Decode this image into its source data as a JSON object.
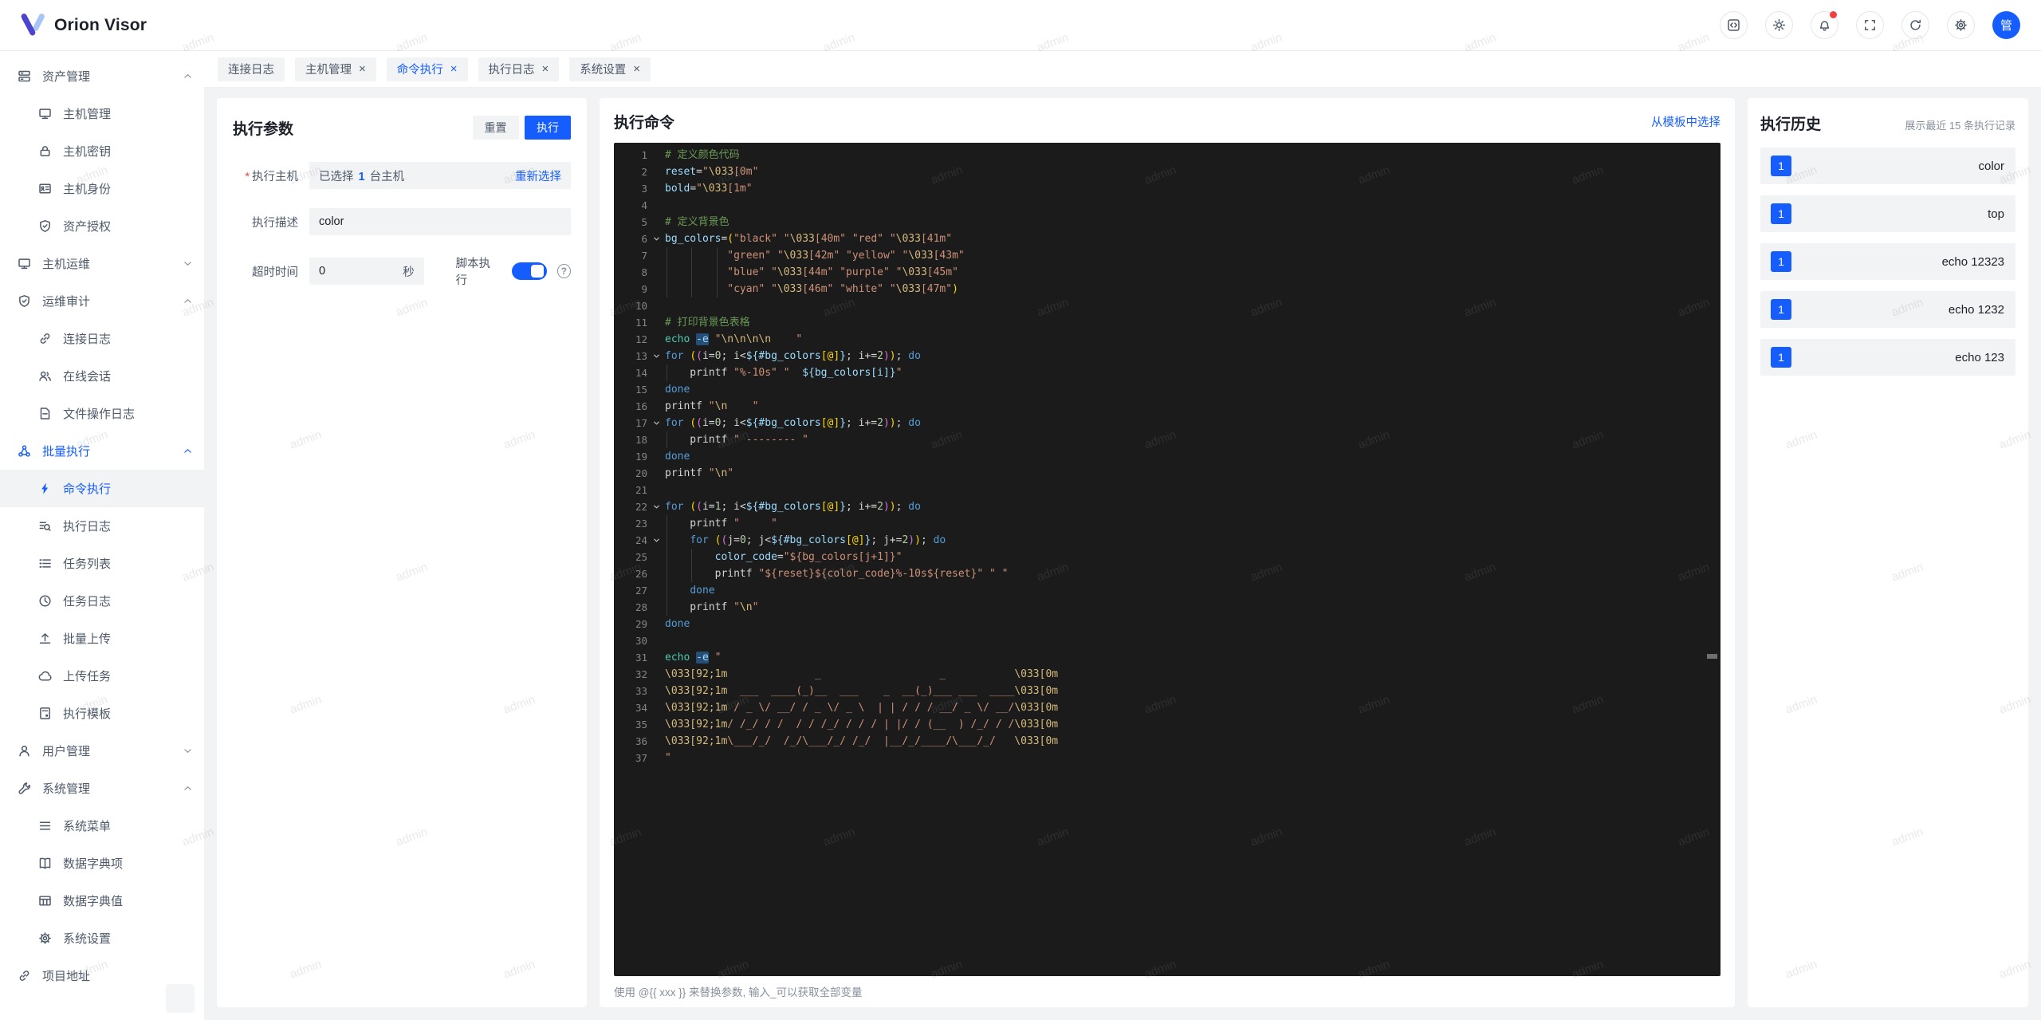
{
  "app": {
    "title": "Orion Visor"
  },
  "colors": {
    "accent": "#165dff",
    "danger": "#f53f3f",
    "editor_bg": "#1b1b1b",
    "success_badge": "#165dff"
  },
  "watermark_text": "admin",
  "header": {
    "avatar_text": "管",
    "actions": [
      {
        "icon": "code-window-icon"
      },
      {
        "icon": "theme-icon"
      },
      {
        "icon": "notifications-icon",
        "badge": true
      },
      {
        "icon": "fullscreen-icon"
      },
      {
        "icon": "refresh-icon"
      },
      {
        "icon": "settings-icon"
      }
    ]
  },
  "tabs": [
    {
      "label": "连接日志",
      "closable": false,
      "active": false
    },
    {
      "label": "主机管理",
      "closable": true,
      "active": false
    },
    {
      "label": "命令执行",
      "closable": true,
      "active": true
    },
    {
      "label": "执行日志",
      "closable": true,
      "active": false
    },
    {
      "label": "系统设置",
      "closable": true,
      "active": false
    }
  ],
  "sidebar": {
    "items": [
      {
        "label": "资产管理",
        "icon": "server",
        "depth": 0,
        "chevron": "up"
      },
      {
        "label": "主机管理",
        "icon": "monitor",
        "depth": 1
      },
      {
        "label": "主机密钥",
        "icon": "lock",
        "depth": 1
      },
      {
        "label": "主机身份",
        "icon": "idcard",
        "depth": 1
      },
      {
        "label": "资产授权",
        "icon": "shield",
        "depth": 1
      },
      {
        "label": "主机运维",
        "icon": "monitor",
        "depth": 0,
        "chevron": "down"
      },
      {
        "label": "运维审计",
        "icon": "shield",
        "depth": 0,
        "chevron": "up"
      },
      {
        "label": "连接日志",
        "icon": "link",
        "depth": 1
      },
      {
        "label": "在线会话",
        "icon": "users",
        "depth": 1
      },
      {
        "label": "文件操作日志",
        "icon": "file",
        "depth": 1
      },
      {
        "label": "批量执行",
        "icon": "cluster",
        "depth": 0,
        "chevron": "up",
        "active": true
      },
      {
        "label": "命令执行",
        "icon": "bolt",
        "depth": 1,
        "active": true,
        "selected": true
      },
      {
        "label": "执行日志",
        "icon": "searchlist",
        "depth": 1
      },
      {
        "label": "任务列表",
        "icon": "list",
        "depth": 1
      },
      {
        "label": "任务日志",
        "icon": "clock",
        "depth": 1
      },
      {
        "label": "批量上传",
        "icon": "upload",
        "depth": 1
      },
      {
        "label": "上传任务",
        "icon": "cloud",
        "depth": 1
      },
      {
        "label": "执行模板",
        "icon": "template",
        "depth": 1
      },
      {
        "label": "用户管理",
        "icon": "user",
        "depth": 0,
        "chevron": "down"
      },
      {
        "label": "系统管理",
        "icon": "wrench",
        "depth": 0,
        "chevron": "up"
      },
      {
        "label": "系统菜单",
        "icon": "menu",
        "depth": 1
      },
      {
        "label": "数据字典项",
        "icon": "book",
        "depth": 1
      },
      {
        "label": "数据字典值",
        "icon": "table",
        "depth": 1
      },
      {
        "label": "系统设置",
        "icon": "gear",
        "depth": 1
      },
      {
        "label": "项目地址",
        "icon": "link",
        "depth": 0
      }
    ]
  },
  "params": {
    "title": "执行参数",
    "reset_label": "重置",
    "run_label": "执行",
    "host": {
      "label": "执行主机",
      "prefix": "已选择",
      "count": "1",
      "suffix": "台主机",
      "reselect": "重新选择"
    },
    "desc": {
      "label": "执行描述",
      "value": "color"
    },
    "timeout": {
      "label": "超时时间",
      "value": "0",
      "unit": "秒"
    },
    "script": {
      "label": "脚本执行",
      "enabled": true
    }
  },
  "command": {
    "title": "执行命令",
    "template_link": "从模板中选择",
    "hint": "使用 @{{ xxx }} 来替换参数, 输入_可以获取全部变量",
    "editor": {
      "lines": [
        {
          "t": [
            [
              "c",
              "# 定义颜色代码"
            ]
          ]
        },
        {
          "t": [
            [
              "v",
              "reset"
            ],
            [
              "p",
              "="
            ],
            [
              "s",
              "\""
            ],
            [
              "e",
              "\\033"
            ],
            [
              "s",
              "[0m\""
            ]
          ]
        },
        {
          "t": [
            [
              "v",
              "bold"
            ],
            [
              "p",
              "="
            ],
            [
              "s",
              "\""
            ],
            [
              "e",
              "\\033"
            ],
            [
              "s",
              "[1m\""
            ]
          ]
        },
        {
          "t": []
        },
        {
          "t": [
            [
              "c",
              "# 定义背景色"
            ]
          ]
        },
        {
          "f": true,
          "t": [
            [
              "v",
              "bg_colors"
            ],
            [
              "p",
              "="
            ],
            [
              "b1",
              "("
            ],
            [
              "s",
              "\"black\""
            ],
            [
              "p",
              " "
            ],
            [
              "s",
              "\""
            ],
            [
              "e",
              "\\033"
            ],
            [
              "s",
              "[40m\""
            ],
            [
              "p",
              " "
            ],
            [
              "s",
              "\"red\""
            ],
            [
              "p",
              " "
            ],
            [
              "s",
              "\""
            ],
            [
              "e",
              "\\033"
            ],
            [
              "s",
              "[41m\""
            ]
          ]
        },
        {
          "t": [
            [
              "p",
              "          "
            ],
            [
              "s",
              "\"green\""
            ],
            [
              "p",
              " "
            ],
            [
              "s",
              "\""
            ],
            [
              "e",
              "\\033"
            ],
            [
              "s",
              "[42m\""
            ],
            [
              "p",
              " "
            ],
            [
              "s",
              "\"yellow\""
            ],
            [
              "p",
              " "
            ],
            [
              "s",
              "\""
            ],
            [
              "e",
              "\\033"
            ],
            [
              "s",
              "[43m\""
            ]
          ]
        },
        {
          "t": [
            [
              "p",
              "          "
            ],
            [
              "s",
              "\"blue\""
            ],
            [
              "p",
              " "
            ],
            [
              "s",
              "\""
            ],
            [
              "e",
              "\\033"
            ],
            [
              "s",
              "[44m\""
            ],
            [
              "p",
              " "
            ],
            [
              "s",
              "\"purple\""
            ],
            [
              "p",
              " "
            ],
            [
              "s",
              "\""
            ],
            [
              "e",
              "\\033"
            ],
            [
              "s",
              "[45m\""
            ]
          ]
        },
        {
          "t": [
            [
              "p",
              "          "
            ],
            [
              "s",
              "\"cyan\""
            ],
            [
              "p",
              " "
            ],
            [
              "s",
              "\""
            ],
            [
              "e",
              "\\033"
            ],
            [
              "s",
              "[46m\""
            ],
            [
              "p",
              " "
            ],
            [
              "s",
              "\"white\""
            ],
            [
              "p",
              " "
            ],
            [
              "s",
              "\""
            ],
            [
              "e",
              "\\033"
            ],
            [
              "s",
              "[47m\""
            ],
            [
              "b1",
              ")"
            ]
          ]
        },
        {
          "t": []
        },
        {
          "t": [
            [
              "c",
              "# 打印背景色表格"
            ]
          ]
        },
        {
          "t": [
            [
              "f",
              "echo"
            ],
            [
              "p",
              " "
            ],
            [
              "hl",
              "-e"
            ],
            [
              "p",
              " "
            ],
            [
              "s",
              "\""
            ],
            [
              "e",
              "\\n\\n\\n\\n"
            ],
            [
              "s",
              "    \""
            ]
          ]
        },
        {
          "f": true,
          "t": [
            [
              "k",
              "for"
            ],
            [
              "p",
              " "
            ],
            [
              "b1",
              "("
            ],
            [
              "b2",
              "("
            ],
            [
              "p",
              "i="
            ],
            [
              "n",
              "0"
            ],
            [
              "p",
              "; i<"
            ],
            [
              "v",
              "${#bg_colors"
            ],
            [
              "b1",
              "[@]"
            ],
            [
              "v",
              "}"
            ],
            [
              "p",
              "; i+="
            ],
            [
              "n",
              "2"
            ],
            [
              "b2",
              ")"
            ],
            [
              "b1",
              ")"
            ],
            [
              "p",
              "; "
            ],
            [
              "k",
              "do"
            ]
          ]
        },
        {
          "t": [
            [
              "p",
              "    printf "
            ],
            [
              "s",
              "\"%-10s\""
            ],
            [
              "p",
              " "
            ],
            [
              "s",
              "\"  "
            ],
            [
              "v",
              "${bg_colors[i]}"
            ],
            [
              "s",
              "\""
            ]
          ]
        },
        {
          "t": [
            [
              "k",
              "done"
            ]
          ]
        },
        {
          "t": [
            [
              "p",
              "printf "
            ],
            [
              "s",
              "\""
            ],
            [
              "e",
              "\\n"
            ],
            [
              "s",
              "    \""
            ]
          ]
        },
        {
          "f": true,
          "t": [
            [
              "k",
              "for"
            ],
            [
              "p",
              " "
            ],
            [
              "b1",
              "("
            ],
            [
              "b2",
              "("
            ],
            [
              "p",
              "i="
            ],
            [
              "n",
              "0"
            ],
            [
              "p",
              "; i<"
            ],
            [
              "v",
              "${#bg_colors"
            ],
            [
              "b1",
              "[@]"
            ],
            [
              "v",
              "}"
            ],
            [
              "p",
              "; i+="
            ],
            [
              "n",
              "2"
            ],
            [
              "b2",
              ")"
            ],
            [
              "b1",
              ")"
            ],
            [
              "p",
              "; "
            ],
            [
              "k",
              "do"
            ]
          ]
        },
        {
          "t": [
            [
              "p",
              "    printf "
            ],
            [
              "s",
              "\" -------- \""
            ]
          ]
        },
        {
          "t": [
            [
              "k",
              "done"
            ]
          ]
        },
        {
          "t": [
            [
              "p",
              "printf "
            ],
            [
              "s",
              "\""
            ],
            [
              "e",
              "\\n"
            ],
            [
              "s",
              "\""
            ]
          ]
        },
        {
          "t": []
        },
        {
          "f": true,
          "t": [
            [
              "k",
              "for"
            ],
            [
              "p",
              " "
            ],
            [
              "b1",
              "("
            ],
            [
              "b2",
              "("
            ],
            [
              "p",
              "i="
            ],
            [
              "n",
              "1"
            ],
            [
              "p",
              "; i<"
            ],
            [
              "v",
              "${#bg_colors"
            ],
            [
              "b1",
              "[@]"
            ],
            [
              "v",
              "}"
            ],
            [
              "p",
              "; i+="
            ],
            [
              "n",
              "2"
            ],
            [
              "b2",
              ")"
            ],
            [
              "b1",
              ")"
            ],
            [
              "p",
              "; "
            ],
            [
              "k",
              "do"
            ]
          ]
        },
        {
          "t": [
            [
              "p",
              "    printf "
            ],
            [
              "s",
              "\"     \""
            ]
          ]
        },
        {
          "f": true,
          "t": [
            [
              "p",
              "    "
            ],
            [
              "k",
              "for"
            ],
            [
              "p",
              " "
            ],
            [
              "b1",
              "("
            ],
            [
              "b2",
              "("
            ],
            [
              "p",
              "j="
            ],
            [
              "n",
              "0"
            ],
            [
              "p",
              "; j<"
            ],
            [
              "v",
              "${#bg_colors"
            ],
            [
              "b1",
              "[@]"
            ],
            [
              "v",
              "}"
            ],
            [
              "p",
              "; j+="
            ],
            [
              "n",
              "2"
            ],
            [
              "b2",
              ")"
            ],
            [
              "b1",
              ")"
            ],
            [
              "p",
              "; "
            ],
            [
              "k",
              "do"
            ]
          ]
        },
        {
          "t": [
            [
              "p",
              "        "
            ],
            [
              "v",
              "color_code"
            ],
            [
              "p",
              "="
            ],
            [
              "s",
              "\"${bg_colors[j+1]}\""
            ]
          ]
        },
        {
          "t": [
            [
              "p",
              "        printf "
            ],
            [
              "s",
              "\"${reset}${color_code}%-10s${reset}\""
            ],
            [
              "p",
              " "
            ],
            [
              "s",
              "\" \""
            ]
          ]
        },
        {
          "t": [
            [
              "p",
              "    "
            ],
            [
              "k",
              "done"
            ]
          ]
        },
        {
          "t": [
            [
              "p",
              "    printf "
            ],
            [
              "s",
              "\""
            ],
            [
              "e",
              "\\n"
            ],
            [
              "s",
              "\""
            ]
          ]
        },
        {
          "t": [
            [
              "k",
              "done"
            ]
          ]
        },
        {
          "t": []
        },
        {
          "t": [
            [
              "f",
              "echo"
            ],
            [
              "p",
              " "
            ],
            [
              "hl",
              "-e"
            ],
            [
              "p",
              " "
            ],
            [
              "s",
              "\""
            ]
          ]
        },
        {
          "t": [
            [
              "e",
              "\\033[92;1m"
            ],
            [
              "s",
              "              _                   _           "
            ],
            [
              "e",
              "\\033[0m"
            ]
          ]
        },
        {
          "t": [
            [
              "e",
              "\\033[92;1m"
            ],
            [
              "s",
              "  ___  ____(_)__  ___    _  __(_)___ ___  ____"
            ],
            [
              "e",
              "\\033[0m"
            ]
          ]
        },
        {
          "t": [
            [
              "e",
              "\\033[92;1m"
            ],
            [
              "s",
              " / _ \\/ __/ / _ \\/ _ \\  | | / / / __/ _ \\/ __/"
            ],
            [
              "e",
              "\\033[0m"
            ]
          ]
        },
        {
          "t": [
            [
              "e",
              "\\033[92;1m"
            ],
            [
              "s",
              "/ /_/ / /  / / /_/ / / / | |/ / (__  ) /_/ / /"
            ],
            [
              "e",
              "\\033[0m"
            ]
          ]
        },
        {
          "t": [
            [
              "e",
              "\\033[92;1m"
            ],
            [
              "s",
              "\\___/_/  /_/\\___/_/ /_/  |__/_/____/\\___/_/   "
            ],
            [
              "e",
              "\\033[0m"
            ]
          ]
        },
        {
          "t": [
            [
              "s",
              "\""
            ]
          ]
        }
      ]
    }
  },
  "history": {
    "title": "执行历史",
    "subtitle": "展示最近 15 条执行记录",
    "items": [
      {
        "badge": "1",
        "text": "color"
      },
      {
        "badge": "1",
        "text": "top"
      },
      {
        "badge": "1",
        "text": "echo 12323"
      },
      {
        "badge": "1",
        "text": "echo 1232"
      },
      {
        "badge": "1",
        "text": "echo 123"
      }
    ]
  }
}
